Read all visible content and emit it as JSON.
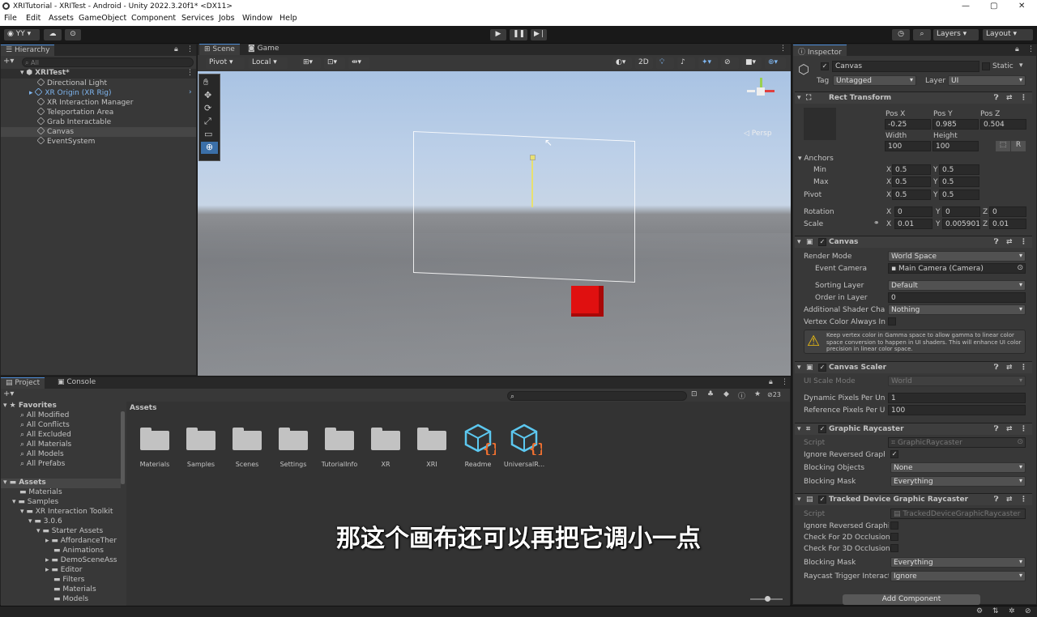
{
  "window": {
    "title": "XRITutorial - XRITest - Android - Unity 2022.3.20f1* <DX11>"
  },
  "menu": [
    "File",
    "Edit",
    "Assets",
    "GameObject",
    "Component",
    "Services",
    "Jobs",
    "Window",
    "Help"
  ],
  "toolbar": {
    "account": "YY",
    "layers": "Layers",
    "layout": "Layout"
  },
  "hierarchy": {
    "tab": "Hierarchy",
    "search_placeholder": "All",
    "scene": "XRITest*",
    "items": [
      "Directional Light",
      "XR Origin (XR Rig)",
      "XR Interaction Manager",
      "Teleportation Area",
      "Grab Interactable",
      "Canvas",
      "EventSystem"
    ]
  },
  "scene_view": {
    "tabs": [
      "Scene",
      "Game"
    ],
    "pivot": "Pivot",
    "local": "Local",
    "mode2d": "2D",
    "persp": "Persp"
  },
  "project": {
    "tabs": [
      "Project",
      "Console"
    ],
    "favorites_label": "Favorites",
    "favorites": [
      "All Modified",
      "All Conflicts",
      "All Excluded",
      "All Materials",
      "All Models",
      "All Prefabs"
    ],
    "tree": [
      {
        "label": "Assets"
      },
      {
        "label": "Materials"
      },
      {
        "label": "Samples"
      },
      {
        "label": "XR Interaction Toolkit"
      },
      {
        "label": "3.0.6"
      },
      {
        "label": "Starter Assets"
      },
      {
        "label": "AffordanceTher"
      },
      {
        "label": "Animations"
      },
      {
        "label": "DemoSceneAss"
      },
      {
        "label": "Editor"
      },
      {
        "label": "Filters"
      },
      {
        "label": "Materials"
      },
      {
        "label": "Models"
      }
    ],
    "breadcrumb": "Assets",
    "count": "23",
    "assets": [
      "Materials",
      "Samples",
      "Scenes",
      "Settings",
      "TutorialInfo",
      "XR",
      "XRI",
      "Readme",
      "UniversalR..."
    ]
  },
  "subtitle": "那这个画布还可以再把它调小一点",
  "inspector": {
    "tab": "Inspector",
    "object_name": "Canvas",
    "static_label": "Static",
    "tag_label": "Tag",
    "tag": "Untagged",
    "layer_label": "Layer",
    "layer": "UI",
    "rect": {
      "title": "Rect Transform",
      "posx_label": "Pos X",
      "posy_label": "Pos Y",
      "posz_label": "Pos Z",
      "posx": "-0.25",
      "posy": "0.985",
      "posz": "0.504",
      "width_label": "Width",
      "height_label": "Height",
      "width": "100",
      "height": "100",
      "anchors": "Anchors",
      "min": "Min",
      "max": "Max",
      "min_x": "0.5",
      "min_y": "0.5",
      "max_x": "0.5",
      "max_y": "0.5",
      "pivot": "Pivot",
      "pivot_x": "0.5",
      "pivot_y": "0.5",
      "rotation": "Rotation",
      "rot_x": "0",
      "rot_y": "0",
      "rot_z": "0",
      "scale": "Scale",
      "scale_x": "0.01",
      "scale_y": "0.005901",
      "scale_z": "0.01",
      "btn_r": "R"
    },
    "canvas": {
      "title": "Canvas",
      "render_mode_label": "Render Mode",
      "render_mode": "World Space",
      "event_camera_label": "Event Camera",
      "event_camera": "Main Camera (Camera)",
      "sorting_layer_label": "Sorting Layer",
      "sorting_layer": "Default",
      "order_label": "Order in Layer",
      "order": "0",
      "shader_label": "Additional Shader Char",
      "shader": "Nothing",
      "vertex_label": "Vertex Color Always In",
      "warning": "Keep vertex color in Gamma space to allow gamma to linear color space conversion to happen in UI shaders. This will enhance UI color precision in linear color space."
    },
    "scaler": {
      "title": "Canvas Scaler",
      "ui_scale_label": "UI Scale Mode",
      "ui_scale": "World",
      "dpu_label": "Dynamic Pixels Per Uni",
      "dpu": "1",
      "rpu_label": "Reference Pixels Per Ui",
      "rpu": "100"
    },
    "raycaster": {
      "title": "Graphic Raycaster",
      "script_label": "Script",
      "script": "GraphicRaycaster",
      "ignore_label": "Ignore Reversed Graphic",
      "blocking_label": "Blocking Objects",
      "blocking": "None",
      "mask_label": "Blocking Mask",
      "mask": "Everything"
    },
    "tracked": {
      "title": "Tracked Device Graphic Raycaster",
      "script_label": "Script",
      "script": "TrackedDeviceGraphicRaycaster",
      "ignore_label": "Ignore Reversed Graphic",
      "check2d_label": "Check For 2D Occlusion",
      "check3d_label": "Check For 3D Occlusion",
      "mask_label": "Blocking Mask",
      "mask": "Everything",
      "trigger_label": "Raycast Trigger Interacti",
      "trigger": "Ignore"
    },
    "add_component": "Add Component"
  },
  "colors": {
    "accent": "#4b8bd6",
    "cube": "#e01010",
    "selection": "#2c5d87"
  }
}
